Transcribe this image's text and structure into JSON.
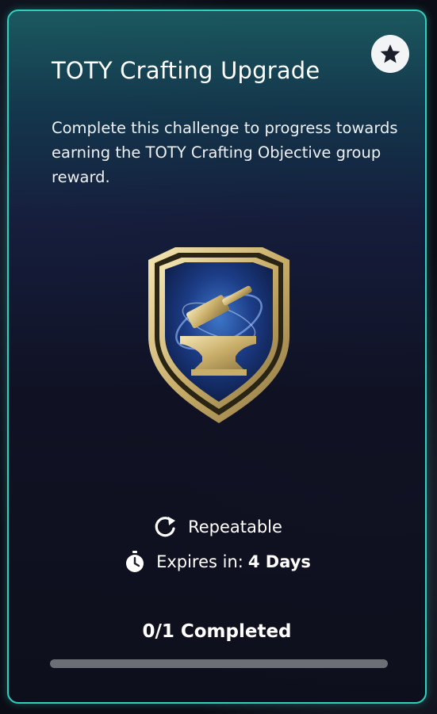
{
  "card": {
    "title": "TOTY Crafting Upgrade",
    "description": "Complete this challenge to progress towards earning the TOTY Crafting Objective group reward.",
    "star_icon": "star-icon",
    "badge_icon": "crafting-anvil-hammer-badge-icon",
    "repeat": {
      "icon": "refresh-icon",
      "label": "Repeatable"
    },
    "expiry": {
      "icon": "stopwatch-icon",
      "label": "Expires in:",
      "value": "4 Days"
    },
    "progress": {
      "text": "0/1 Completed",
      "completed": 0,
      "total": 1
    }
  },
  "colors": {
    "accent_border": "#2fd0c0",
    "badge_gold": "#d8c486",
    "progress_track": "#6c6f76"
  }
}
